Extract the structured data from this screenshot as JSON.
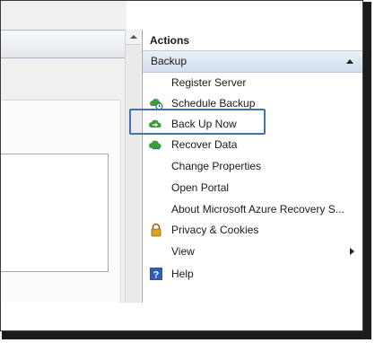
{
  "actions": {
    "title": "Actions",
    "section": "Backup",
    "items": [
      {
        "label": "Register Server",
        "icon": "none"
      },
      {
        "label": "Schedule Backup",
        "icon": "cloud-schedule-icon"
      },
      {
        "label": "Back Up Now",
        "icon": "cloud-backup-icon"
      },
      {
        "label": "Recover Data",
        "icon": "cloud-recover-icon"
      },
      {
        "label": "Change Properties",
        "icon": "none"
      },
      {
        "label": "Open Portal",
        "icon": "none"
      },
      {
        "label": "About Microsoft Azure Recovery S...",
        "icon": "none"
      },
      {
        "label": "Privacy & Cookies",
        "icon": "lock-icon"
      },
      {
        "label": "View",
        "icon": "none"
      },
      {
        "label": "Help",
        "icon": "help-icon"
      }
    ]
  },
  "colors": {
    "highlight": "#3f72b3",
    "section_header": "#d2deec",
    "icon_green": "#3a9c3a",
    "help_blue": "#2f5fb3",
    "lock_gold": "#d9a520"
  }
}
